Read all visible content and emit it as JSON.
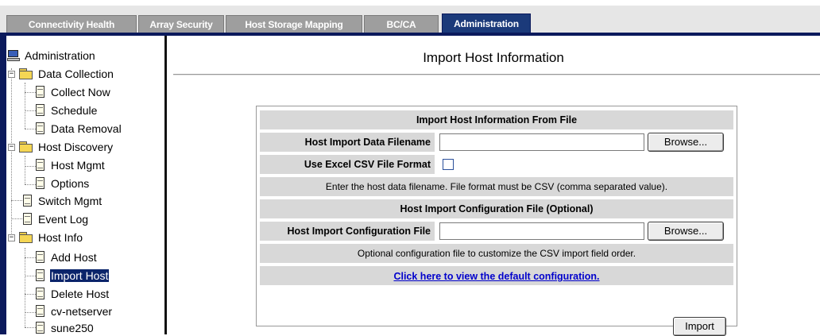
{
  "tabs": [
    {
      "label": "Connectivity Health",
      "active": false
    },
    {
      "label": "Array Security",
      "active": false
    },
    {
      "label": "Host Storage Mapping",
      "active": false
    },
    {
      "label": "BC/CA",
      "active": false
    },
    {
      "label": "Administration",
      "active": true
    }
  ],
  "sidebar": {
    "root": "Administration",
    "items": [
      {
        "label": "Data Collection",
        "type": "folder",
        "expanded": true
      },
      {
        "label": "Collect Now",
        "type": "doc"
      },
      {
        "label": "Schedule",
        "type": "doc"
      },
      {
        "label": "Data Removal",
        "type": "doc"
      },
      {
        "label": "Host Discovery",
        "type": "folder",
        "expanded": true
      },
      {
        "label": "Host Mgmt",
        "type": "doc"
      },
      {
        "label": "Options",
        "type": "doc"
      },
      {
        "label": "Switch Mgmt",
        "type": "doc"
      },
      {
        "label": "Event Log",
        "type": "doc"
      },
      {
        "label": "Host Info",
        "type": "folder",
        "expanded": true
      },
      {
        "label": "Add Host",
        "type": "doc"
      },
      {
        "label": "Import Host",
        "type": "doc",
        "selected": true
      },
      {
        "label": "Delete Host",
        "type": "doc"
      },
      {
        "label": "cv-netserver",
        "type": "doc"
      },
      {
        "label": "sune250",
        "type": "doc"
      }
    ]
  },
  "main": {
    "title": "Import Host Information",
    "section1": {
      "header": "Import Host Information From File",
      "filename_label": "Host Import Data Filename",
      "filename_value": "",
      "browse_label": "Browse...",
      "csv_label": "Use Excel CSV File Format",
      "csv_checked": false,
      "note": "Enter the host data filename. File format must be CSV (comma separated value)."
    },
    "section2": {
      "header": "Host Import Configuration File (Optional)",
      "config_label": "Host Import Configuration File",
      "config_value": "",
      "browse_label": "Browse...",
      "note": "Optional configuration file to customize the CSV import field order.",
      "link_text": "Click here to view the default configuration."
    },
    "import_button": "Import"
  },
  "colors": {
    "tab_active": "#1b3a7a",
    "tab_inactive": "#9e9e9e",
    "selection": "#0a246a",
    "link": "#0000cc",
    "row_bg": "#d8d8d8"
  }
}
